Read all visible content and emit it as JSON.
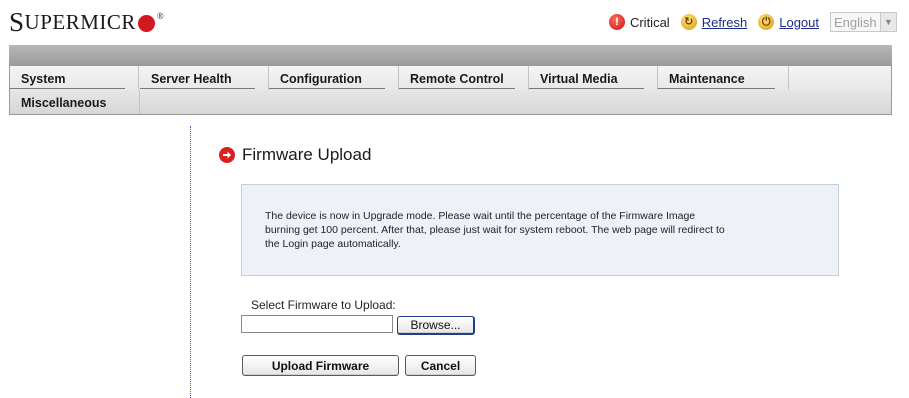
{
  "header": {
    "logo_text_big": "S",
    "logo_text_small": "UPERMICR",
    "logo_trademark": "®",
    "status_label": "Critical",
    "refresh_label": "Refresh",
    "logout_label": "Logout",
    "language_selected": "English"
  },
  "menu": {
    "items": [
      {
        "label": "System"
      },
      {
        "label": "Server Health"
      },
      {
        "label": "Configuration"
      },
      {
        "label": "Remote Control"
      },
      {
        "label": "Virtual Media"
      },
      {
        "label": "Maintenance"
      },
      {
        "label": "Miscellaneous"
      }
    ]
  },
  "content": {
    "title": "Firmware Upload",
    "message": "The device is now in Upgrade mode. Please wait until the percentage of the Firmware Image burning get 100 percent. After that, please just wait for system reboot. The web page will redirect to the Login page automatically.",
    "select_label": "Select Firmware to Upload:",
    "file_value": "",
    "browse_label": "Browse...",
    "upload_label": "Upload Firmware",
    "cancel_label": "Cancel"
  },
  "colors": {
    "brand_red": "#d21820",
    "link_blue": "#1d2d8a",
    "message_bg": "#eef2f8"
  },
  "icons": {
    "status": "critical-alert-icon",
    "refresh": "refresh-icon",
    "logout": "logout-icon",
    "title": "arrow-right-circle-icon"
  }
}
